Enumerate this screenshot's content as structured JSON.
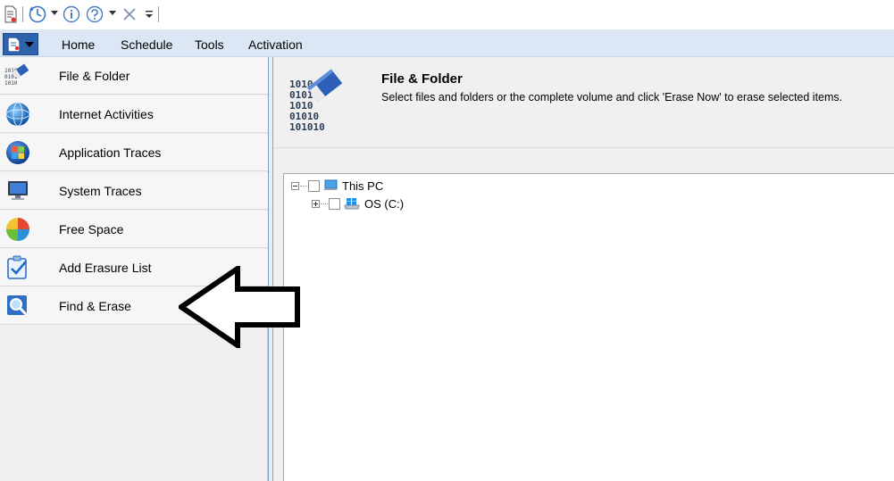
{
  "ribbon": {
    "tabs": [
      {
        "label": "Home"
      },
      {
        "label": "Schedule"
      },
      {
        "label": "Tools"
      },
      {
        "label": "Activation"
      }
    ]
  },
  "nav": {
    "items": [
      {
        "label": "File & Folder",
        "icon": "eraser-binary-icon"
      },
      {
        "label": "Internet Activities",
        "icon": "globe-icon"
      },
      {
        "label": "Application Traces",
        "icon": "windows-logo-icon"
      },
      {
        "label": "System Traces",
        "icon": "monitor-icon"
      },
      {
        "label": "Free Space",
        "icon": "pie-chart-icon"
      },
      {
        "label": "Add Erasure List",
        "icon": "checklist-icon"
      },
      {
        "label": "Find & Erase",
        "icon": "magnifier-icon"
      }
    ]
  },
  "content": {
    "title": "File & Folder",
    "description": "Select files and folders or the complete volume and click 'Erase Now' to erase selected items.",
    "icon": "eraser-binary-icon",
    "tree": {
      "root": {
        "label": "This PC",
        "icon": "computer-icon",
        "expanded": true,
        "checked": false
      },
      "children": [
        {
          "label": "OS (C:)",
          "icon": "windows-drive-icon",
          "expanded": false,
          "checked": false
        }
      ]
    }
  },
  "colors": {
    "menubar_bg": "#dbe7f4",
    "app_menu_button": "#2e62ad",
    "splitter_border": "#7da2ce",
    "pane_bg": "#f0f0f0"
  }
}
